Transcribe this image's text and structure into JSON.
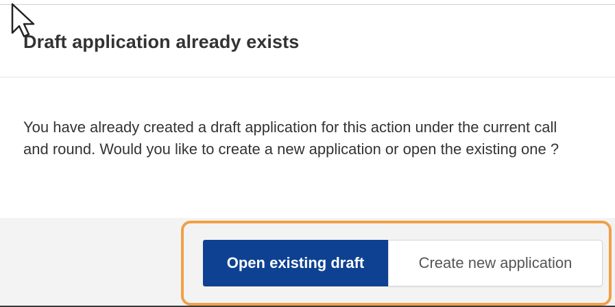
{
  "dialog": {
    "title": "Draft application already exists",
    "message": "You have already created a draft application for this action under the current call and round. Would you like to create a new application or open the existing one ?",
    "buttons": {
      "open_existing": "Open existing draft",
      "create_new": "Create new application"
    }
  },
  "colors": {
    "primary_button": "#0e4191",
    "highlight_border": "#f0a046",
    "footer_background": "#f3f3f3"
  },
  "icons": {
    "cursor": "mouse-pointer-icon"
  }
}
